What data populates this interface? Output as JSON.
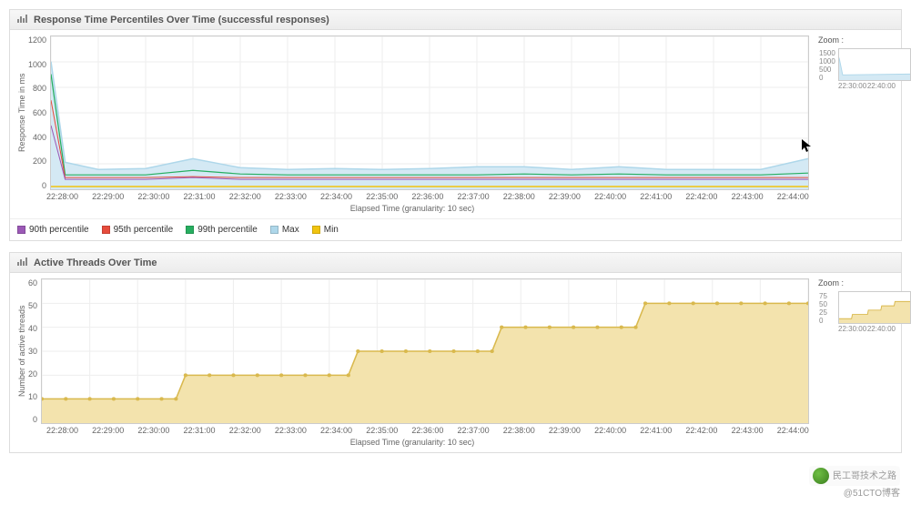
{
  "chart_data": [
    {
      "type": "line",
      "title": "Response Time Percentiles Over Time (successful responses)",
      "xlabel": "Elapsed Time (granularity: 10 sec)",
      "ylabel": "Response Time in ms",
      "ylim": [
        0,
        1200
      ],
      "yticks": [
        0,
        200,
        400,
        600,
        800,
        1000,
        1200
      ],
      "categories": [
        "22:28:00",
        "22:29:00",
        "22:30:00",
        "22:31:00",
        "22:32:00",
        "22:33:00",
        "22:34:00",
        "22:35:00",
        "22:36:00",
        "22:37:00",
        "22:38:00",
        "22:39:00",
        "22:40:00",
        "22:41:00",
        "22:42:00",
        "22:43:00",
        "22:44:00"
      ],
      "series": [
        {
          "name": "90th percentile",
          "color": "#9b59b6",
          "values": [
            500,
            80,
            80,
            90,
            80,
            80,
            80,
            80,
            80,
            80,
            80,
            80,
            80,
            80,
            80,
            80,
            80
          ]
        },
        {
          "name": "95th percentile",
          "color": "#e74c3c",
          "values": [
            700,
            90,
            90,
            100,
            90,
            90,
            90,
            90,
            90,
            90,
            90,
            90,
            90,
            90,
            90,
            90,
            90
          ]
        },
        {
          "name": "99th percentile",
          "color": "#27ae60",
          "values": [
            900,
            110,
            110,
            150,
            120,
            110,
            110,
            110,
            110,
            110,
            120,
            110,
            120,
            110,
            110,
            110,
            130
          ]
        },
        {
          "name": "Max",
          "color": "#aed7ea",
          "values": [
            1000,
            150,
            160,
            240,
            200,
            170,
            160,
            170,
            160,
            180,
            180,
            170,
            180,
            170,
            160,
            170,
            240
          ]
        },
        {
          "name": "Min",
          "color": "#f1c40f",
          "values": [
            20,
            20,
            20,
            20,
            20,
            20,
            20,
            20,
            20,
            20,
            20,
            20,
            20,
            20,
            20,
            20,
            20
          ]
        }
      ],
      "zoom": {
        "label": "Zoom :",
        "yticks": [
          0,
          500,
          1000,
          1500
        ],
        "xticks": [
          "22:30:00",
          "22:40:00"
        ]
      }
    },
    {
      "type": "area",
      "title": "Active Threads Over Time",
      "xlabel": "Elapsed Time (granularity: 10 sec)",
      "ylabel": "Number of active threads",
      "ylim": [
        0,
        60
      ],
      "yticks": [
        0,
        10,
        20,
        30,
        40,
        50,
        60
      ],
      "categories": [
        "22:28:00",
        "22:29:00",
        "22:30:00",
        "22:31:00",
        "22:32:00",
        "22:33:00",
        "22:34:00",
        "22:35:00",
        "22:36:00",
        "22:37:00",
        "22:38:00",
        "22:39:00",
        "22:40:00",
        "22:41:00",
        "22:42:00",
        "22:43:00",
        "22:44:00"
      ],
      "series": [
        {
          "name": "Active Threads",
          "color": "#e8c76b",
          "values": [
            10,
            10,
            10,
            20,
            20,
            20,
            20,
            30,
            30,
            30,
            40,
            40,
            40,
            50,
            50,
            50,
            50
          ]
        }
      ],
      "zoom": {
        "label": "Zoom :",
        "yticks": [
          0,
          25,
          50,
          75
        ],
        "xticks": [
          "22:30:00",
          "22:40:00"
        ]
      }
    }
  ],
  "watermark": {
    "line1": "民工哥技术之路",
    "line2": "@51CTO博客"
  }
}
